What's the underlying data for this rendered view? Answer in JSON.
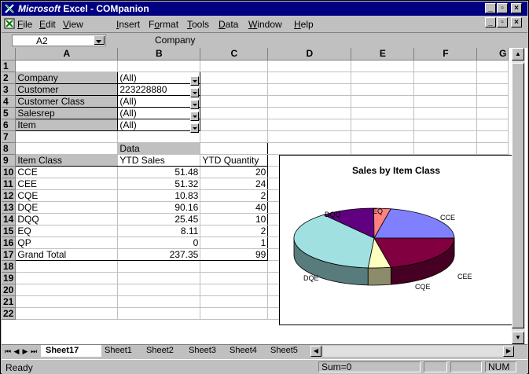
{
  "window": {
    "title_prefix": "Microsoft",
    "title_suffix": " Excel - COMpanion",
    "min_label": "_",
    "max_label": "▫",
    "close_label": "×"
  },
  "menu": {
    "items": [
      {
        "key": "F",
        "rest": "ile"
      },
      {
        "key": "E",
        "rest": "dit"
      },
      {
        "key": "V",
        "rest": "iew"
      },
      {
        "key": "I",
        "rest": "nsert"
      },
      {
        "key": "o",
        "pre": "F",
        "rest": "rmat"
      },
      {
        "key": "T",
        "rest": "ools"
      },
      {
        "key": "D",
        "rest": "ata"
      },
      {
        "key": "W",
        "rest": "indow"
      },
      {
        "key": "H",
        "rest": "elp"
      }
    ]
  },
  "formula_bar": {
    "name_box": "A2",
    "value": "Company"
  },
  "columns": [
    "A",
    "B",
    "C",
    "D",
    "E",
    "F",
    "G"
  ],
  "rows": [
    "1",
    "2",
    "3",
    "4",
    "5",
    "6",
    "7",
    "8",
    "9",
    "10",
    "11",
    "12",
    "13",
    "14",
    "15",
    "16",
    "17",
    "18",
    "19",
    "20",
    "21",
    "22"
  ],
  "pivot": {
    "page_fields": [
      {
        "label": "Company",
        "value": "(All)"
      },
      {
        "label": "Customer",
        "value": "223228880"
      },
      {
        "label": "Customer  Class",
        "value": "(All)"
      },
      {
        "label": "Salesrep",
        "value": "(All)"
      },
      {
        "label": "Item",
        "value": "(All)"
      }
    ],
    "data_label": "Data",
    "row_header": "Item Class",
    "col_headers": [
      "YTD Sales",
      "YTD Quantity"
    ],
    "rows": [
      {
        "cls": "CCE",
        "sales": "51.48",
        "qty": "20"
      },
      {
        "cls": "CEE",
        "sales": "51.32",
        "qty": "24"
      },
      {
        "cls": "CQE",
        "sales": "10.83",
        "qty": "2"
      },
      {
        "cls": "DQE",
        "sales": "90.16",
        "qty": "40"
      },
      {
        "cls": "DQQ",
        "sales": "25.45",
        "qty": "10"
      },
      {
        "cls": "EQ",
        "sales": "8.11",
        "qty": "2"
      },
      {
        "cls": "QP",
        "sales": "0",
        "qty": "1"
      }
    ],
    "total": {
      "cls": "Grand Total",
      "sales": "237.35",
      "qty": "99"
    }
  },
  "chart_data": {
    "type": "pie",
    "title": "Sales by Item Class",
    "categories": [
      "CCE",
      "CEE",
      "CQE",
      "DQE",
      "DQQ",
      "EQ"
    ],
    "values": [
      51.48,
      51.32,
      10.83,
      90.16,
      25.45,
      8.11
    ],
    "colors": [
      "#8080ff",
      "#800040",
      "#ffffc0",
      "#a0e0e0",
      "#600080",
      "#ff8080"
    ]
  },
  "tabs": {
    "nav": [
      "⏮",
      "◀",
      "▶",
      "⏭"
    ],
    "items": [
      "Sheet17",
      "Sheet1",
      "Sheet2",
      "Sheet3",
      "Sheet4",
      "Sheet5"
    ],
    "active": "Sheet17"
  },
  "status": {
    "mode": "Ready",
    "sum": "Sum=0",
    "num": "NUM"
  }
}
